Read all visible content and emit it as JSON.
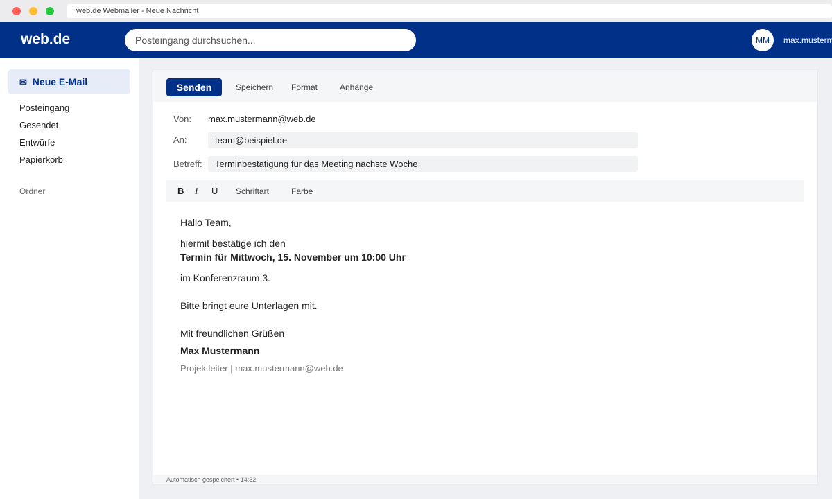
{
  "window": {
    "title": "web.de Webmailer - Neue Nachricht"
  },
  "header": {
    "logo": "web.de",
    "search_placeholder": "Posteingang durchsuchen...",
    "avatar_initials": "MM",
    "username": "max.mustermann"
  },
  "sidebar": {
    "new_mail_icon": "✉",
    "new_mail_label": "Neue E-Mail",
    "items": [
      {
        "label": "Posteingang"
      },
      {
        "label": "Gesendet"
      },
      {
        "label": "Entwürfe"
      },
      {
        "label": "Papierkorb"
      }
    ],
    "section_label": "Ordner"
  },
  "toolbar": {
    "send_label": "Senden",
    "save_label": "Speichern",
    "format_label": "Format",
    "attachments_label": "Anhänge"
  },
  "fields": {
    "from_label": "Von:",
    "from_value": "max.mustermann@web.de",
    "to_label": "An:",
    "to_value": "team@beispiel.de",
    "subject_label": "Betreff:",
    "subject_value": "Terminbestätigung für das Meeting nächste Woche"
  },
  "format_bar": {
    "bold": "B",
    "italic": "I",
    "underline": "U",
    "font": "Schriftart",
    "color": "Farbe"
  },
  "message": {
    "greeting": "Hallo Team,",
    "line1": "hiermit bestätige ich den",
    "line2": "Termin für Mittwoch, 15. November um 10:00 Uhr",
    "line3": "im Konferenzraum 3.",
    "line4": "Bitte bringt eure Unterlagen mit.",
    "closing": "Mit freundlichen Grüßen",
    "signature_name": "Max Mustermann",
    "signature_meta": "Projektleiter | max.mustermann@web.de"
  },
  "status": {
    "autosave": "Automatisch gespeichert • 14:32"
  },
  "colors": {
    "brand": "#003087",
    "accent_bg": "#e6ecf8"
  }
}
